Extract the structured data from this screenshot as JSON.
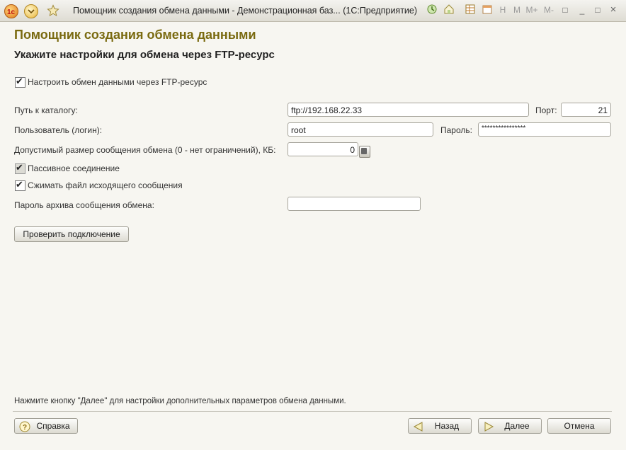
{
  "window": {
    "title": "Помощник создания обмена данными - Демонстрационная баз... (1С:Предприятие)",
    "controls": [
      "H",
      "M",
      "M+",
      "M-",
      "□",
      "_",
      "□",
      "×"
    ]
  },
  "page": {
    "heading": "Помощник создания обмена данными",
    "subheading": "Укажите настройки для обмена через FTP-ресурс"
  },
  "form": {
    "setup_checkbox_label": "Настроить обмен данными через FTP-ресурс",
    "path_label": "Путь к каталогу:",
    "path_value": "ftp://192.168.22.33",
    "port_label": "Порт:",
    "port_value": "21",
    "user_label": "Пользователь (логин):",
    "user_value": "root",
    "password_label": "Пароль:",
    "password_value": "****************",
    "max_size_label": "Допустимый размер сообщения обмена (0 - нет ограничений), КБ:",
    "max_size_value": "0",
    "passive_label": "Пассивное соединение",
    "compress_label": "Сжимать файл исходящего сообщения",
    "archive_password_label": "Пароль архива сообщения обмена:",
    "archive_password_value": "",
    "test_button": "Проверить подключение"
  },
  "footer": {
    "hint": "Нажмите кнопку \"Далее\" для настройки дополнительных параметров обмена данными.",
    "help_button": "Справка",
    "back_button": "Назад",
    "next_button": "Далее",
    "cancel_button": "Отмена"
  }
}
